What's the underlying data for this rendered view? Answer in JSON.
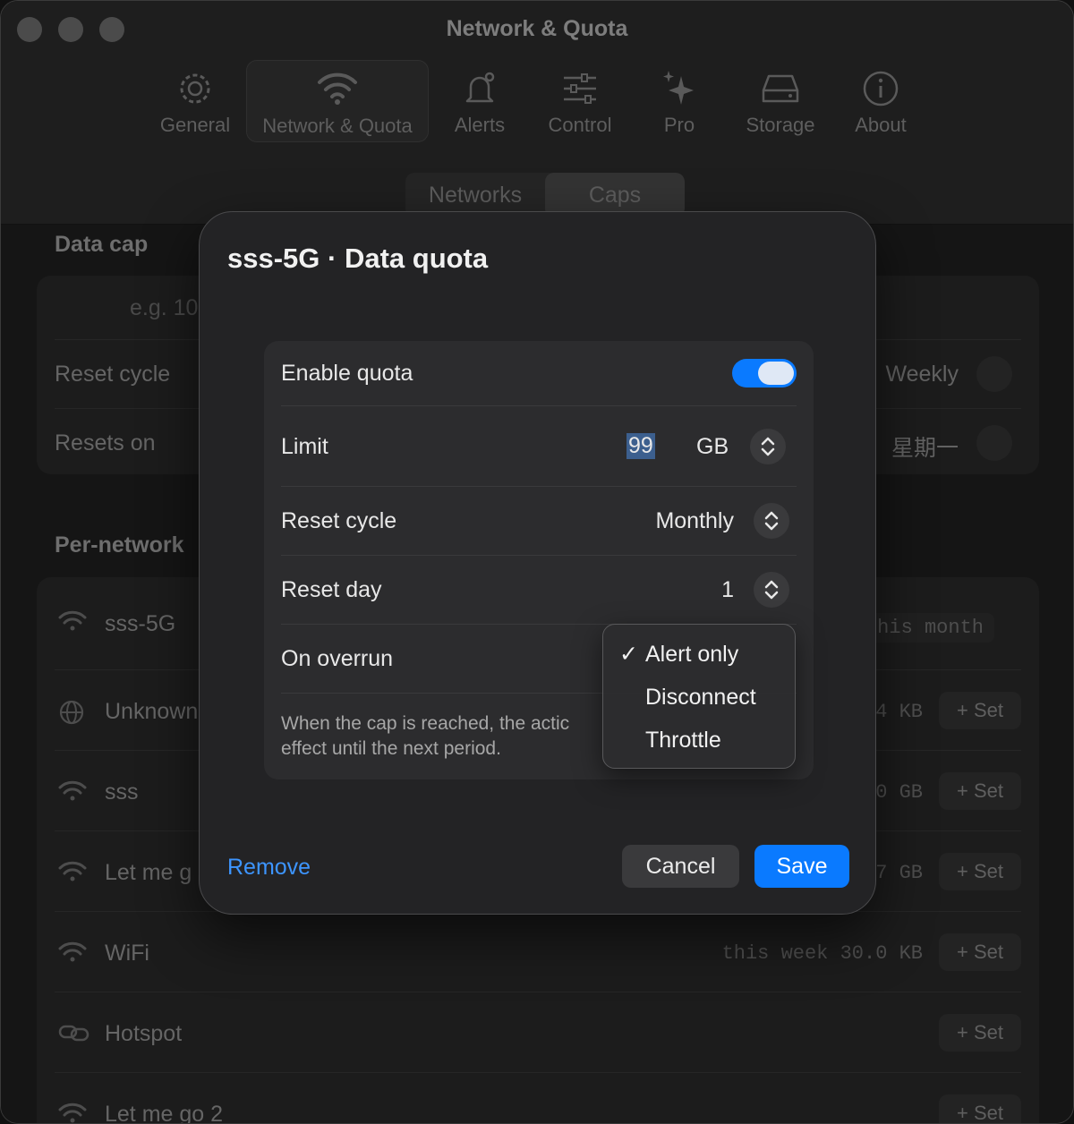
{
  "window": {
    "title": "Network & Quota"
  },
  "toolbar": [
    {
      "label": "General",
      "icon": "gear-icon"
    },
    {
      "label": "Network & Quota",
      "icon": "wifi-icon"
    },
    {
      "label": "Alerts",
      "icon": "bell-icon"
    },
    {
      "label": "Control",
      "icon": "sliders-icon"
    },
    {
      "label": "Pro",
      "icon": "sparkles-icon"
    },
    {
      "label": "Storage",
      "icon": "drive-icon"
    },
    {
      "label": "About",
      "icon": "info-icon"
    }
  ],
  "segmented": {
    "networks": "Networks",
    "caps": "Caps",
    "selected": "Caps"
  },
  "data_cap": {
    "heading": "Data cap",
    "placeholder": "e.g. 10",
    "reset_cycle_label": "Reset cycle",
    "reset_cycle_value": "Weekly",
    "resets_on_label": "Resets on",
    "resets_on_value": "星期一"
  },
  "per_network": {
    "heading": "Per-network",
    "rows": [
      {
        "name": "sss-5G",
        "icon": "wifi-icon",
        "usage": "his month",
        "action": "✎"
      },
      {
        "name": "Unknown",
        "icon": "globe-icon",
        "usage": "4 KB",
        "action": "+ Set"
      },
      {
        "name": "sss",
        "icon": "wifi-icon",
        "usage": "0 GB",
        "action": "+ Set"
      },
      {
        "name": "Let me g",
        "icon": "wifi-icon",
        "usage": "7 GB",
        "action": "+ Set"
      },
      {
        "name": "WiFi",
        "icon": "wifi-icon",
        "usage": "this week 30.0 KB",
        "action": "+ Set"
      },
      {
        "name": "Hotspot",
        "icon": "link-icon",
        "usage": "",
        "action": "+ Set"
      },
      {
        "name": "Let me go 2",
        "icon": "wifi-icon",
        "usage": "",
        "action": "+ Set"
      }
    ]
  },
  "modal": {
    "title": "sss-5G · Data quota",
    "enable_label": "Enable quota",
    "enable_on": true,
    "limit_label": "Limit",
    "limit_value": "99",
    "limit_unit": "GB",
    "reset_cycle_label": "Reset cycle",
    "reset_cycle_value": "Monthly",
    "reset_day_label": "Reset day",
    "reset_day_value": "1",
    "overrun_label": "On overrun",
    "hint_line1": "When the cap is reached, the actic",
    "hint_line2": "effect until the next period.",
    "menu": {
      "selected": "Alert only",
      "options": [
        "Alert only",
        "Disconnect",
        "Throttle"
      ]
    },
    "remove": "Remove",
    "cancel": "Cancel",
    "save": "Save"
  },
  "colors": {
    "accent": "#0a7aff",
    "link": "#3d95ff"
  }
}
